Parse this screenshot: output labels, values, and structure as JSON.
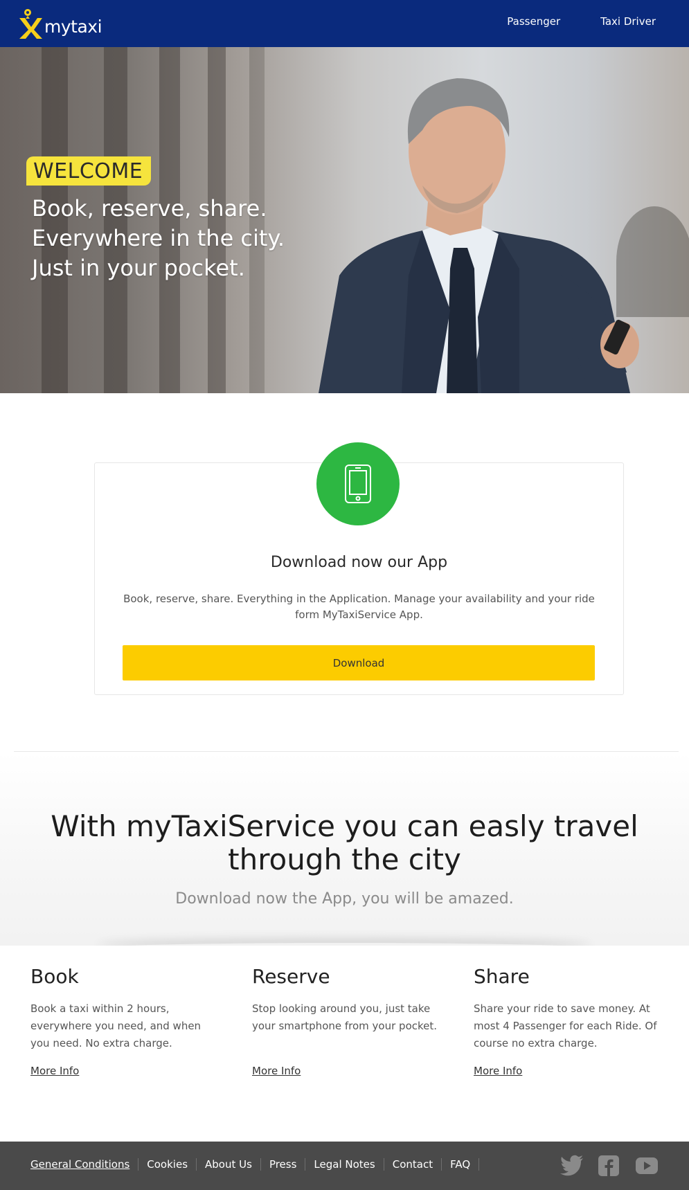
{
  "header": {
    "brand": "mytaxi",
    "nav": [
      "Passenger",
      "Taxi Driver"
    ],
    "colors": {
      "bar": "#0a2a7d",
      "logo_x": "#f6cf1a"
    }
  },
  "hero": {
    "badge": "WELCOME",
    "lines": [
      "Book, reserve, share.",
      "Everywhere in the city.",
      "Just in your pocket."
    ]
  },
  "app_card": {
    "icon": "smartphone-icon",
    "title": "Download now our App",
    "text": "Book, reserve, share. Everything in the Application. Manage your availability and your ride form MyTaxiService App.",
    "button": "Download",
    "colors": {
      "circle": "#2db742",
      "button": "#fccc00"
    }
  },
  "travel": {
    "title": "With myTaxiService you can easly travel through the city",
    "subtitle": "Download now the App, you will be amazed."
  },
  "features": [
    {
      "title": "Book",
      "text": "Book a taxi within 2 hours, everywhere you need, and when you need. No extra charge.",
      "link": "More Info"
    },
    {
      "title": "Reserve",
      "text": "Stop looking around you, just take your smartphone from your pocket.",
      "link": "More Info"
    },
    {
      "title": "Share",
      "text": "Share your ride to save money. At most 4 Passenger for each Ride. Of course no extra charge.",
      "link": "More Info"
    }
  ],
  "footer": {
    "links": [
      "General Conditions",
      "Cookies",
      "About Us",
      "Press",
      "Legal Notes",
      "Contact",
      "FAQ"
    ],
    "social": [
      "twitter-icon",
      "facebook-icon",
      "youtube-icon"
    ]
  }
}
